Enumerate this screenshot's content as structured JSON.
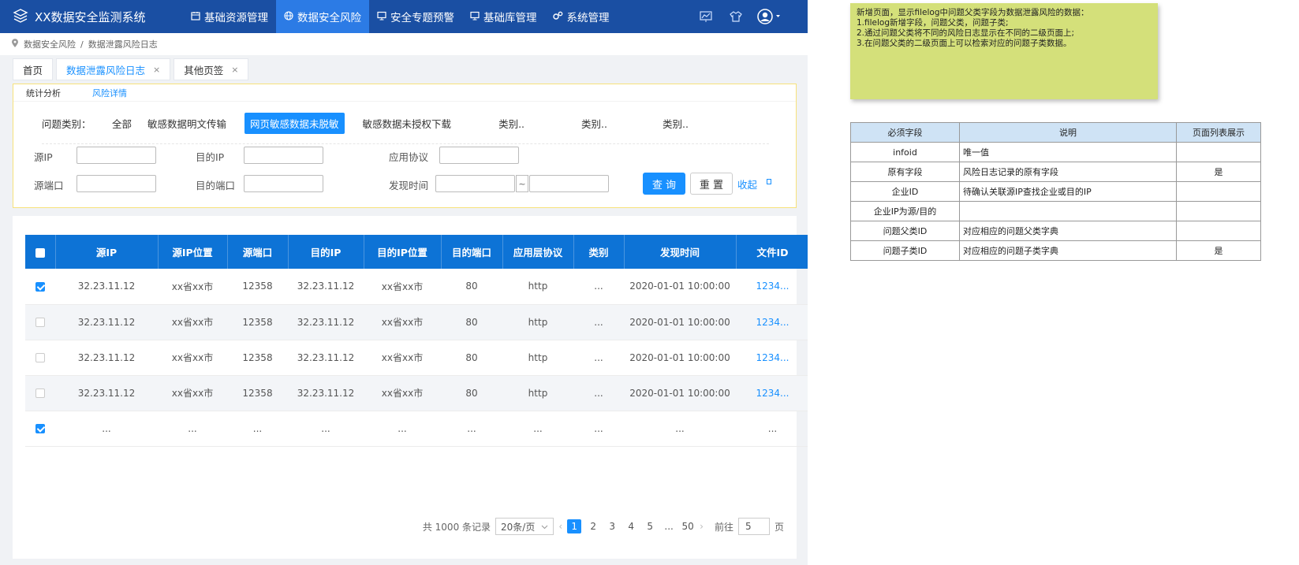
{
  "app": {
    "title": "XX数据安全监测系统",
    "nav": [
      {
        "label": "基础资源管理",
        "icon": "calendar-icon"
      },
      {
        "label": "数据安全风险",
        "icon": "globe-icon"
      },
      {
        "label": "安全专题预警",
        "icon": "monitor-icon"
      },
      {
        "label": "基础库管理",
        "icon": "monitor-icon"
      },
      {
        "label": "系统管理",
        "icon": "gears-icon"
      }
    ],
    "colors": {
      "topbar": "#1a4fa3",
      "active_nav": "#2c7be5",
      "accent": "#1890ff",
      "table_header": "#0d73d6",
      "note": "#d4e07a"
    }
  },
  "breadcrumb": {
    "root": "数据安全风险",
    "separator": "/",
    "current": "数据泄露风险日志"
  },
  "tabs": [
    {
      "label": "首页"
    },
    {
      "label": "数据泄露风险日志",
      "close": "×"
    },
    {
      "label": "其他页签",
      "close": "×"
    }
  ],
  "subtabs": [
    "统计分析",
    "风险详情"
  ],
  "filter": {
    "category_label": "问题类别：",
    "categories": [
      "全部",
      "敏感数据明文传输",
      "网页敏感数据未脱敏",
      "敏感数据未授权下载",
      "类别..",
      "类别..",
      "类别.."
    ],
    "fields": {
      "src_ip": "源IP",
      "dst_ip": "目的IP",
      "protocol": "应用协议",
      "src_port": "源端口",
      "dst_port": "目的端口",
      "found_time": "发现时间"
    },
    "range_sep": "~",
    "query_button": "查 询",
    "reset_button": "重 置",
    "collapse": "收起"
  },
  "table": {
    "columns": [
      "源IP",
      "源IP位置",
      "源端口",
      "目的IP",
      "目的IP位置",
      "目的端口",
      "应用层协议",
      "类别",
      "发现时间",
      "文件ID"
    ],
    "rows": [
      {
        "checked": true,
        "cells": [
          "32.23.11.12",
          "xx省xx市",
          "12358",
          "32.23.11.12",
          "xx省xx市",
          "80",
          "http",
          "...",
          "2020-01-01  10:00:00",
          "1234..."
        ]
      },
      {
        "checked": false,
        "cells": [
          "32.23.11.12",
          "xx省xx市",
          "12358",
          "32.23.11.12",
          "xx省xx市",
          "80",
          "http",
          "...",
          "2020-01-01  10:00:00",
          "1234..."
        ]
      },
      {
        "checked": false,
        "cells": [
          "32.23.11.12",
          "xx省xx市",
          "12358",
          "32.23.11.12",
          "xx省xx市",
          "80",
          "http",
          "...",
          "2020-01-01  10:00:00",
          "1234..."
        ]
      },
      {
        "checked": false,
        "cells": [
          "32.23.11.12",
          "xx省xx市",
          "12358",
          "32.23.11.12",
          "xx省xx市",
          "80",
          "http",
          "...",
          "2020-01-01  10:00:00",
          "1234..."
        ]
      },
      {
        "checked": true,
        "cells": [
          "...",
          "...",
          "...",
          "...",
          "...",
          "...",
          "...",
          "...",
          "...",
          "..."
        ]
      }
    ]
  },
  "pagination": {
    "total": "共 1000 条记录",
    "page_size": "20条/页",
    "pages": [
      "1",
      "2",
      "3",
      "4",
      "5",
      "...",
      "50"
    ],
    "current_page": "1",
    "goto_label": "前往",
    "goto_value": "5",
    "page_suffix": "页"
  },
  "note": {
    "lines": [
      "新增页面，显示filelog中问题父类字段为数据泄露风险的数据：",
      "1.filelog新增字段，问题父类，问题子类;",
      "2.通过问题父类将不同的风险日志显示在不同的二级页面上;",
      "3.在问题父类的二级页面上可以检索对应的问题子类数据。"
    ]
  },
  "spec": {
    "headers": [
      "必须字段",
      "说明",
      "页面列表展示"
    ],
    "rows": [
      [
        "infoid",
        "唯一值",
        ""
      ],
      [
        "原有字段",
        "风险日志记录的原有字段",
        "是"
      ],
      [
        "企业ID",
        "待确认关联源IP查找企业或目的IP",
        ""
      ],
      [
        "企业IP为源/目的",
        "",
        ""
      ],
      [
        "问题父类ID",
        "对应相应的问题父类字典",
        ""
      ],
      [
        "问题子类ID",
        "对应相应的问题子类字典",
        "是"
      ]
    ]
  }
}
